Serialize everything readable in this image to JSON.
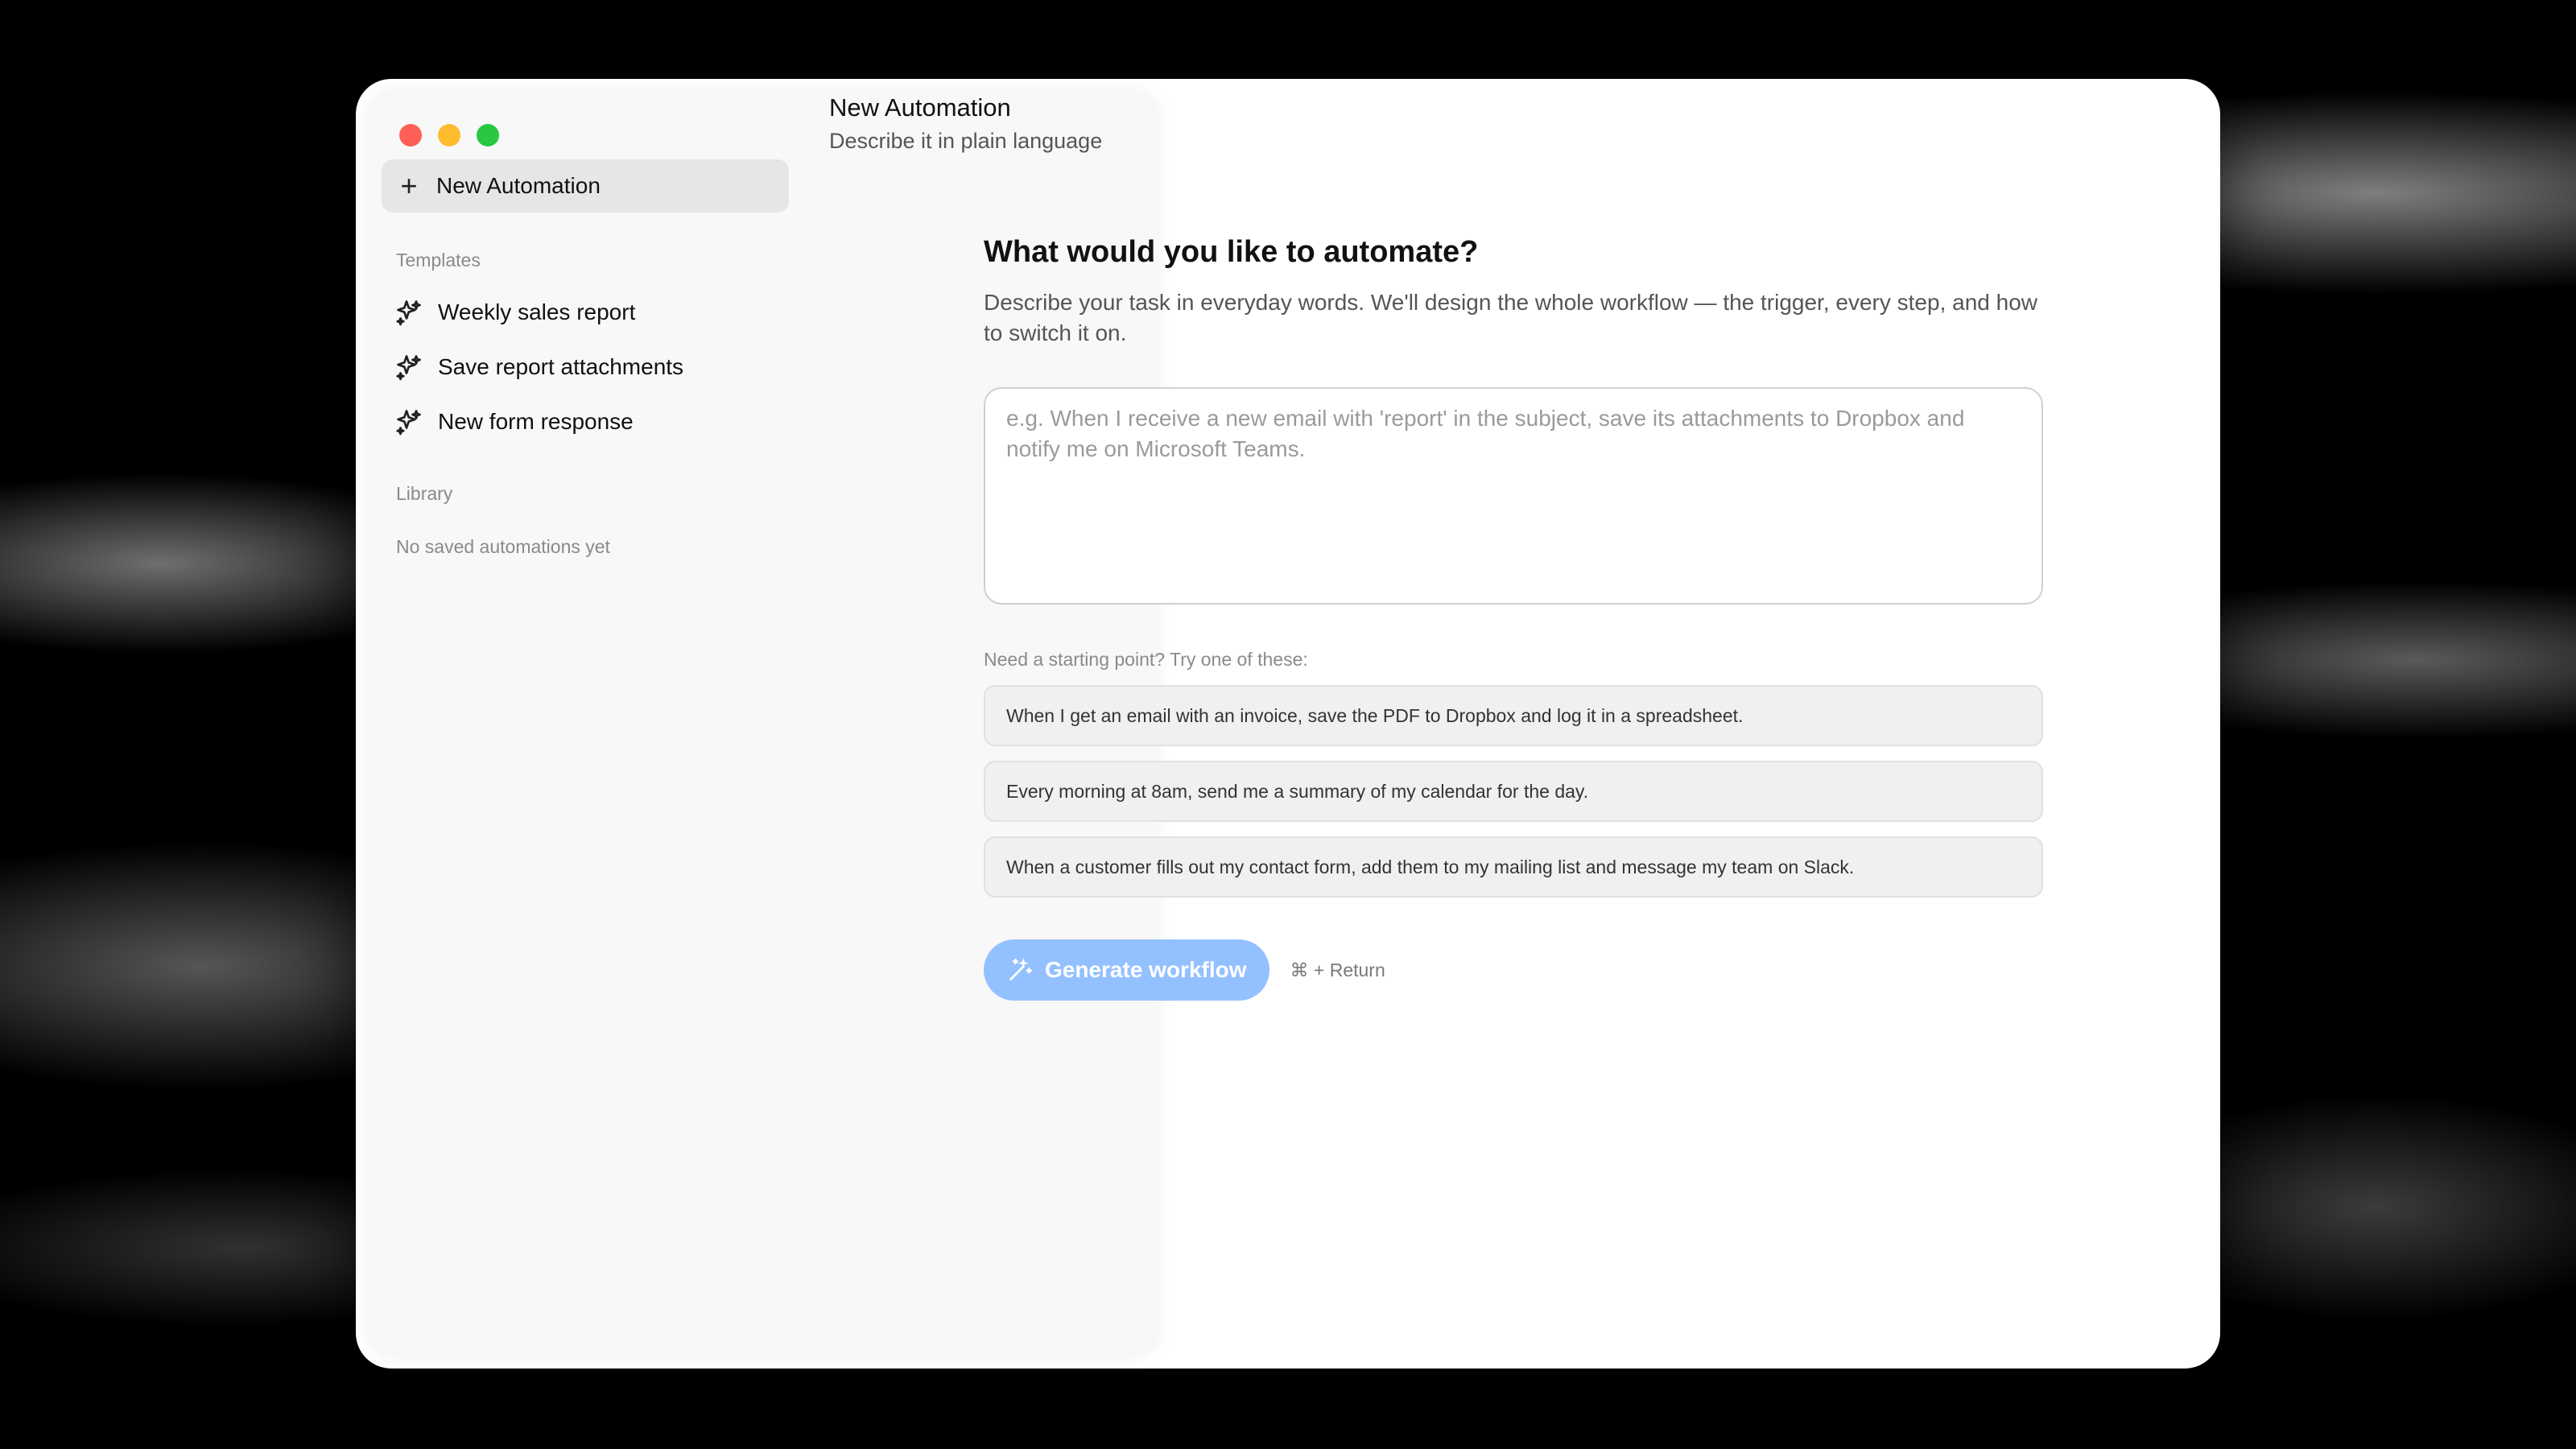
{
  "sidebar": {
    "new_button": "New Automation",
    "templates_label": "Templates",
    "templates": [
      {
        "label": "Weekly sales report"
      },
      {
        "label": "Save report attachments"
      },
      {
        "label": "New form response"
      }
    ],
    "library_label": "Library",
    "library_empty": "No saved automations yet"
  },
  "header": {
    "title": "New Automation",
    "subtitle": "Describe it in plain language"
  },
  "main": {
    "question": "What would you like to automate?",
    "description": "Describe your task in everyday words. We'll design the whole workflow — the trigger, every step, and how to switch it on.",
    "input_placeholder": "e.g. When I receive a new email with 'report' in the subject, save its attachments to Dropbox and notify me on Microsoft Teams.",
    "input_value": "",
    "suggestions_label": "Need a starting point? Try one of these:",
    "suggestions": [
      "When I get an email with an invoice, save the PDF to Dropbox and log it in a spreadsheet.",
      "Every morning at 8am, send me a summary of my calendar for the day.",
      "When a customer fills out my contact form, add them to my mailing list and message my team on Slack."
    ],
    "generate_button": "Generate workflow",
    "shortcut_hint": "⌘ + Return"
  },
  "colors": {
    "accent": "#93c0ff",
    "close": "#fe5f57",
    "minimize": "#febc2e",
    "zoom": "#28c840"
  },
  "icons": {
    "new": "plus-icon",
    "template": "sparkle-icon",
    "generate": "magic-wand-icon"
  }
}
